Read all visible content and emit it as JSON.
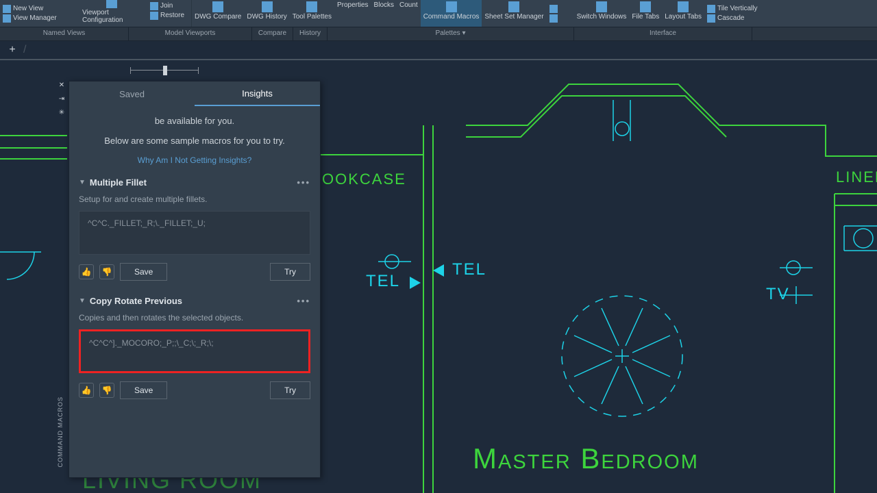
{
  "ribbon": {
    "new_view": "New View",
    "view_manager": "View Manager",
    "viewport_config": "Viewport Configuration",
    "join": "Join",
    "restore": "Restore",
    "dwg_compare": "DWG Compare",
    "dwg_history": "DWG History",
    "tool_palettes": "Tool Palettes",
    "properties": "Properties",
    "blocks": "Blocks",
    "count": "Count",
    "command_macros": "Command Macros",
    "sheet_set": "Sheet Set Manager",
    "switch_windows": "Switch Windows",
    "file_tabs": "File Tabs",
    "layout_tabs": "Layout Tabs",
    "tile_vert": "Tile Vertically",
    "cascade": "Cascade"
  },
  "panels": {
    "named_views": "Named Views",
    "model_viewports": "Model Viewports",
    "compare": "Compare",
    "history": "History",
    "palettes": "Palettes ▾",
    "interface": "Interface"
  },
  "palette": {
    "title": "COMMAND MACROS",
    "tab_saved": "Saved",
    "tab_insights": "Insights",
    "intro1": "be available for you.",
    "intro2": "Below are some sample macros for you to try.",
    "link": "Why Am I Not Getting Insights?",
    "save_btn": "Save",
    "try_btn": "Try",
    "macros": [
      {
        "title": "Multiple Fillet",
        "desc": "Setup for and create multiple fillets.",
        "code": "^C^C._FILLET;_R;\\._FILLET;_U;"
      },
      {
        "title": "Copy Rotate Previous",
        "desc": "Copies and then rotates the selected objects.",
        "code": "^C^C^]._MOCORO;_P;;\\_C;\\;_R;\\;"
      }
    ]
  },
  "drawing": {
    "bookcase": "OOKCASE",
    "tel": "TEL",
    "tv": "TV",
    "liner": "LINER",
    "master_bedroom": "Master Bedroom",
    "living_room": "LIVING  ROOM"
  }
}
